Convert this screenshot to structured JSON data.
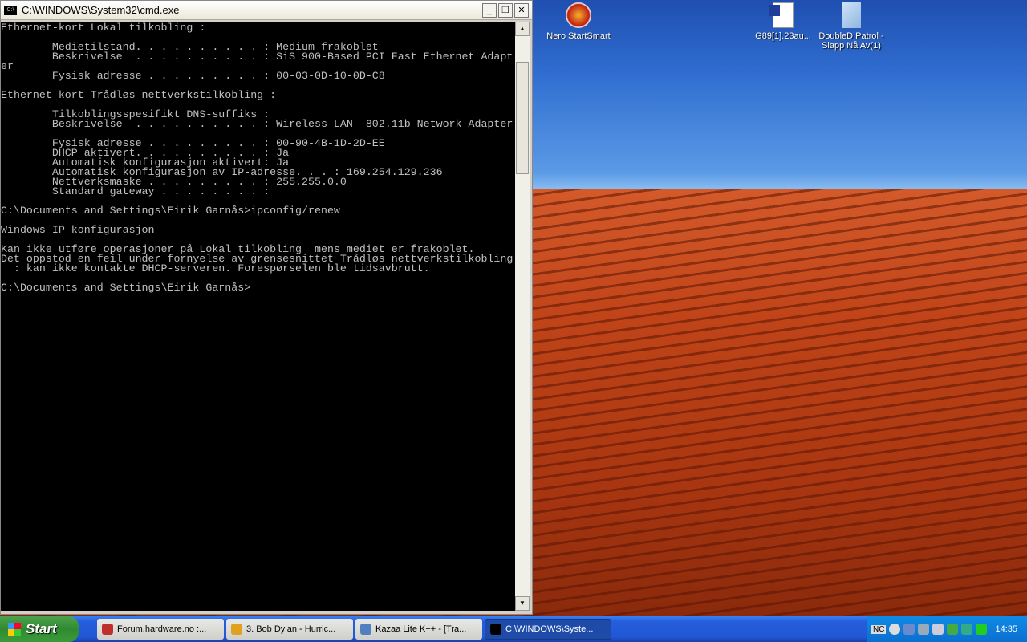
{
  "cmd_window": {
    "title": "C:\\WINDOWS\\System32\\cmd.exe",
    "icon_label": "C:\\",
    "lines": [
      "Ethernet-kort Lokal tilkobling :",
      "",
      "        Medietilstand. . . . . . . . . . : Medium frakoblet",
      "        Beskrivelse  . . . . . . . . . . : SiS 900-Based PCI Fast Ethernet Adapt",
      "er",
      "        Fysisk adresse . . . . . . . . . : 00-03-0D-10-0D-C8",
      "",
      "Ethernet-kort Trådløs nettverkstilkobling :",
      "",
      "        Tilkoblingsspesifikt DNS-suffiks :",
      "        Beskrivelse  . . . . . . . . . . : Wireless LAN  802.11b Network Adapter",
      "",
      "        Fysisk adresse . . . . . . . . . : 00-90-4B-1D-2D-EE",
      "        DHCP aktivert. . . . . . . . . . : Ja",
      "        Automatisk konfigurasjon aktivert: Ja",
      "        Automatisk konfigurasjon av IP-adresse. . . : 169.254.129.236",
      "        Nettverksmaske . . . . . . . . . : 255.255.0.0",
      "        Standard gateway . . . . . . . . :",
      "",
      "C:\\Documents and Settings\\Eirik Garnås>ipconfig/renew",
      "",
      "Windows IP-konfigurasjon",
      "",
      "Kan ikke utføre operasjoner på Lokal tilkobling  mens mediet er frakoblet.",
      "Det oppstod en feil under fornyelse av grensesnittet Trådløs nettverkstilkobling",
      "  : kan ikke kontakte DHCP-serveren. Forespørselen ble tidsavbrutt.",
      "",
      "C:\\Documents and Settings\\Eirik Garnås>"
    ]
  },
  "desktop_icons": [
    {
      "label": "Nero StartSmart",
      "icon": "nero-icon"
    },
    {
      "label": "G89[1].23au...",
      "icon": "word-document-icon"
    },
    {
      "label": "DoubleD Patrol - Slapp Nå Av(1)",
      "icon": "winamp-file-icon"
    }
  ],
  "taskbar": {
    "start_label": "Start",
    "tasks": [
      {
        "label": "Forum.hardware.no :...",
        "color": "#c0302a",
        "active": false
      },
      {
        "label": "3. Bob Dylan - Hurric...",
        "color": "#e0a020",
        "active": false
      },
      {
        "label": "Kazaa Lite K++ - [Tra...",
        "color": "#5080c0",
        "active": false
      },
      {
        "label": "C:\\WINDOWS\\Syste...",
        "color": "#000000",
        "active": true
      }
    ],
    "tray_text": "NC",
    "clock": "14:35"
  }
}
